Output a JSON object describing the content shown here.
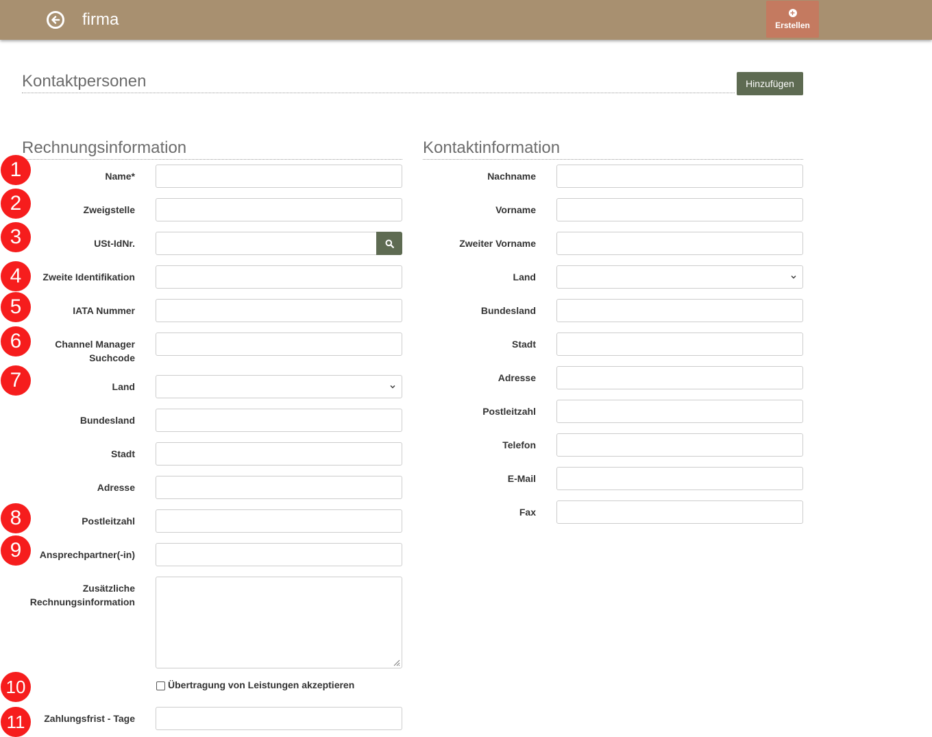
{
  "header": {
    "title": "firma",
    "create_label": "Erstellen",
    "bg_color": "#a89070",
    "create_color": "#c47a60"
  },
  "contacts": {
    "title": "Kontaktpersonen",
    "add_label": "Hinzufügen"
  },
  "billing": {
    "title": "Rechnungsinformation",
    "name": "Name*",
    "branch": "Zweigstelle",
    "vat": "USt-IdNr.",
    "second_id": "Zweite Identifikation",
    "iata": "IATA Nummer",
    "channel_line1": "Channel Manager",
    "channel_line2": "Suchcode",
    "country": "Land",
    "state": "Bundesland",
    "city": "Stadt",
    "address": "Adresse",
    "zip": "Postleitzahl",
    "contact_person": "Ansprechpartner(-in)",
    "additional_line1": "Zusätzliche",
    "additional_line2": "Rechnungsinformation",
    "accept_transfer": "Übertragung von Leistungen akzeptieren",
    "payment_terms": "Zahlungsfrist - Tage"
  },
  "contact_info": {
    "title": "Kontaktinformation",
    "last_name": "Nachname",
    "first_name": "Vorname",
    "middle_name": "Zweiter Vorname",
    "country": "Land",
    "state": "Bundesland",
    "city": "Stadt",
    "address": "Adresse",
    "zip": "Postleitzahl",
    "phone": "Telefon",
    "email": "E-Mail",
    "fax": "Fax"
  },
  "markers": [
    "1",
    "2",
    "3",
    "4",
    "5",
    "6",
    "7",
    "8",
    "9",
    "10",
    "11"
  ],
  "accent_color": "#5e6b52",
  "marker_color": "#f61d1d"
}
